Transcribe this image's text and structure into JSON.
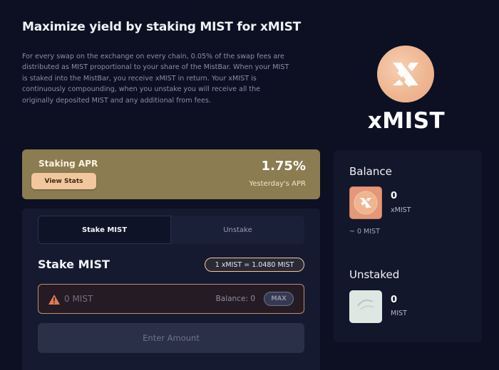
{
  "header": {
    "title": "Maximize yield by staking MIST for xMIST",
    "description": "For every swap on the exchange on every chain, 0.05% of the swap fees are distributed as MIST proportional to your share of the MistBar. When your MIST is staked into the MistBar, you receive xMIST in return. Your xMIST is continuously compounding, when you unstake you will receive all the originally deposited MIST and any additional from fees."
  },
  "logo": {
    "text": "xMIST",
    "icon": "xmist-logo-icon",
    "color": "#eeb58f"
  },
  "apr": {
    "label": "Staking APR",
    "button": "View Stats",
    "value": "1.75%",
    "subtext": "Yesterday's APR"
  },
  "stake": {
    "tabs": [
      {
        "label": "Stake MIST",
        "active": true
      },
      {
        "label": "Unstake",
        "active": false
      }
    ],
    "title": "Stake MIST",
    "rate": "1 xMIST = 1.0480 MIST",
    "input_placeholder": "0 MIST",
    "balance_label": "Balance: 0",
    "max_label": "MAX",
    "submit_label": "Enter Amount"
  },
  "balance": {
    "title": "Balance",
    "amount": "0",
    "symbol": "xMIST",
    "approx": "~ 0 MIST"
  },
  "unstaked": {
    "title": "Unstaked",
    "amount": "0",
    "symbol": "MIST"
  }
}
